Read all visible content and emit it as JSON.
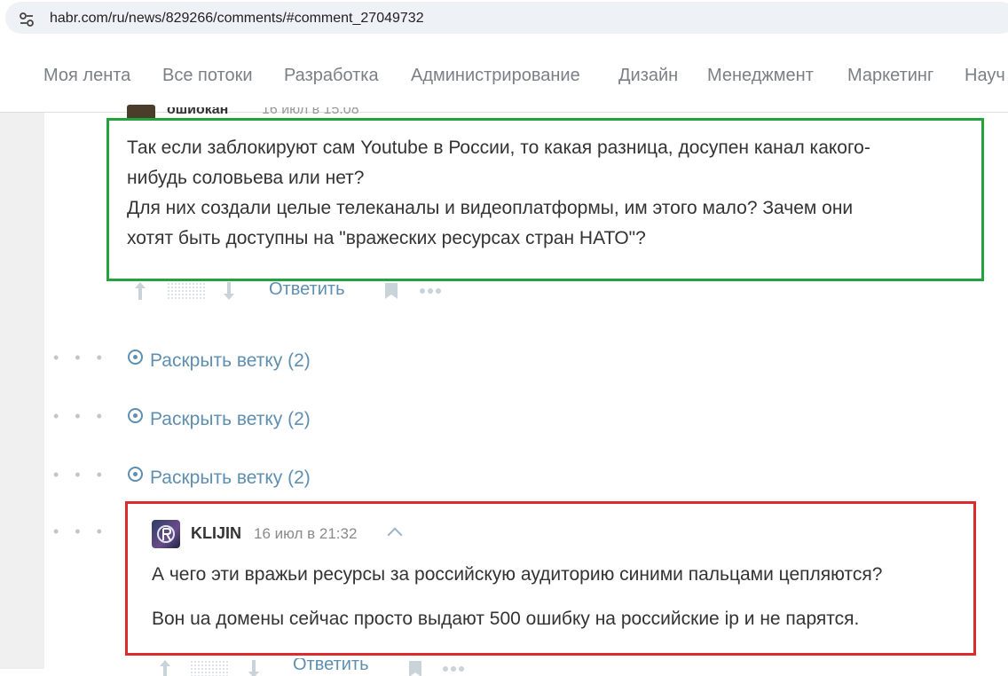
{
  "browser": {
    "url": "habr.com/ru/news/829266/comments/#comment_27049732",
    "site_info_icon": "tune-icon"
  },
  "nav": {
    "items": [
      {
        "label": "Моя лента"
      },
      {
        "label": "Все потоки"
      },
      {
        "label": "Разработка"
      },
      {
        "label": "Администрирование"
      },
      {
        "label": "Дизайн"
      },
      {
        "label": "Менеджмент"
      },
      {
        "label": "Маркетинг"
      },
      {
        "label": "Науч"
      }
    ]
  },
  "comment1": {
    "author_partial": "ошиокан",
    "date_partial": "16 июл в 15:08",
    "lines": [
      "Так если заблокируют сам Youtube в России, то какая разница, досупен канал какого-",
      "нибудь соловьева или нет?",
      "Для них создали целые телеканалы и видеоплатформы, им этого мало? Зачем они",
      "хотят быть доступны на \"вражеских ресурсах стран НАТО\"?"
    ],
    "reply_label": "Ответить",
    "highlight_color": "#22a33c"
  },
  "threads": [
    {
      "label": "Раскрыть ветку (2)"
    },
    {
      "label": "Раскрыть ветку (2)"
    },
    {
      "label": "Раскрыть ветку (2)"
    }
  ],
  "comment2": {
    "author": "KLIJIN",
    "date": "16 июл в 21:32",
    "paragraphs": [
      "А чего эти вражьи ресурсы за российскую аудиторию синими пальцами цепляются?",
      "Вон ua домены сейчас просто выдают 500 ошибку на российские ip и не парятся."
    ],
    "reply_label": "Ответить",
    "highlight_color": "#dd2a2d"
  },
  "colors": {
    "link": "#5e8fb0",
    "nav_text": "#7b8085",
    "icon_gray": "#c9d3da"
  }
}
